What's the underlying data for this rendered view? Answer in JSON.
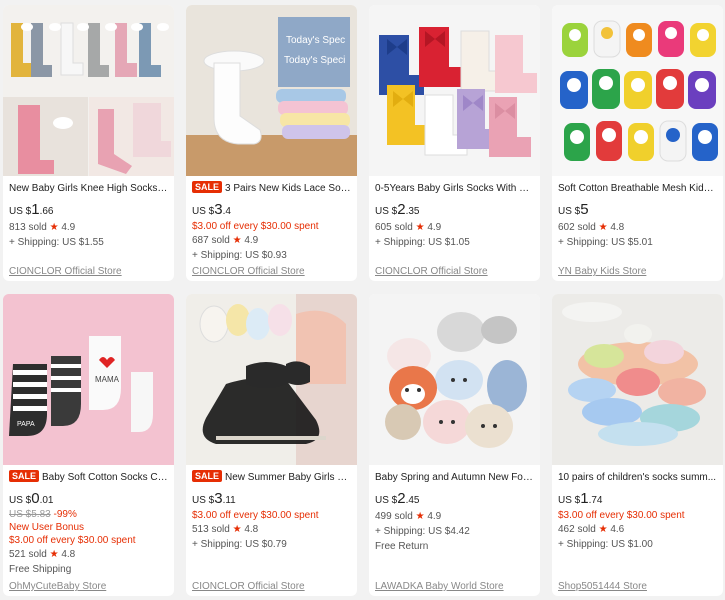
{
  "products": [
    {
      "title": "New Baby Girls Knee High Socks A...",
      "sale": "",
      "price_prefix": "US $",
      "price_int": "1",
      "price_dec": ".66",
      "old_price": "",
      "discount": "",
      "badge": "",
      "promo": "",
      "sold": "813 sold",
      "rating": "4.9",
      "shipping": "+ Shipping: US $1.55",
      "extra": "",
      "store": "CIONCLOR Official Store"
    },
    {
      "title": "3 Pairs New Kids Lace Sock...",
      "sale": "SALE",
      "price_prefix": "US $",
      "price_int": "3",
      "price_dec": ".4",
      "old_price": "",
      "discount": "",
      "badge": "",
      "promo": "$3.00 off every $30.00 spent",
      "sold": "687 sold",
      "rating": "4.9",
      "shipping": "+ Shipping: US $0.93",
      "extra": "",
      "store": "CIONCLOR Official Store"
    },
    {
      "title": "0-5Years Baby Girls Socks With Big...",
      "sale": "",
      "price_prefix": "US $",
      "price_int": "2",
      "price_dec": ".35",
      "old_price": "",
      "discount": "",
      "badge": "",
      "promo": "",
      "sold": "605 sold",
      "rating": "4.9",
      "shipping": "+ Shipping: US $1.05",
      "extra": "",
      "store": "CIONCLOR Official Store"
    },
    {
      "title": "Soft Cotton Breathable Mesh Kids ...",
      "sale": "",
      "price_prefix": "US $",
      "price_int": "5",
      "price_dec": "",
      "old_price": "",
      "discount": "",
      "badge": "",
      "promo": "",
      "sold": "602 sold",
      "rating": "4.8",
      "shipping": "+ Shipping: US $5.01",
      "extra": "",
      "store": "YN Baby Kids Store"
    },
    {
      "title": "Baby Soft Cotton Socks Cut...",
      "sale": "SALE",
      "price_prefix": "US $",
      "price_int": "0",
      "price_dec": ".01",
      "old_price": "US $5.83",
      "discount": "-99%",
      "badge": "New User Bonus",
      "promo": "$3.00 off every $30.00 spent",
      "sold": "521 sold",
      "rating": "4.8",
      "shipping": "",
      "extra": "Free Shipping",
      "store": "OhMyCuteBaby Store"
    },
    {
      "title": "New Summer Baby Girls Ki...",
      "sale": "SALE",
      "price_prefix": "US $",
      "price_int": "3",
      "price_dec": ".11",
      "old_price": "",
      "discount": "",
      "badge": "",
      "promo": "$3.00 off every $30.00 spent",
      "sold": "513 sold",
      "rating": "4.8",
      "shipping": "+ Shipping: US $0.79",
      "extra": "",
      "store": "CIONCLOR Official Store"
    },
    {
      "title": "Baby Spring and Autumn New Foo...",
      "sale": "",
      "price_prefix": "US $",
      "price_int": "2",
      "price_dec": ".45",
      "old_price": "",
      "discount": "",
      "badge": "",
      "promo": "",
      "sold": "499 sold",
      "rating": "4.9",
      "shipping": "+ Shipping: US $4.42",
      "extra": "Free Return",
      "store": "LAWADKA Baby World Store"
    },
    {
      "title": "10 pairs of children's socks summ...",
      "sale": "",
      "price_prefix": "US $",
      "price_int": "1",
      "price_dec": ".74",
      "old_price": "",
      "discount": "",
      "badge": "",
      "promo": "$3.00 off every $30.00 spent",
      "sold": "462 sold",
      "rating": "4.6",
      "shipping": "+ Shipping: US $1.00",
      "extra": "",
      "store": "Shop5051444 Store"
    }
  ],
  "image_text": {
    "box_text_1": "Today's Spec",
    "box_text_2": "Today's Speci",
    "papa": "PAPA",
    "mama": "MAMA"
  },
  "colors": {
    "accent": "#e62e04",
    "store": "#888888",
    "background": "#f2f2f2"
  }
}
